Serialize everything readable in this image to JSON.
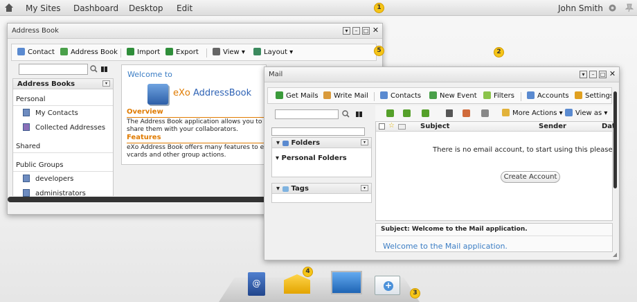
{
  "topbar": {
    "menu": [
      "My Sites",
      "Dashboard",
      "Desktop",
      "Edit"
    ],
    "user": "John Smith",
    "icons": [
      "home-icon",
      "gear-icon",
      "pin-icon"
    ]
  },
  "badges": {
    "b1": "1",
    "b2": "2",
    "b3": "3",
    "b4": "4",
    "b5": "5"
  },
  "addressbook": {
    "title": "Address Book",
    "toolbar": [
      "Contact",
      "Address Book",
      "Import",
      "Export",
      "View",
      "Layout"
    ],
    "panel_title": "Address Books",
    "sections": {
      "personal": "Personal",
      "shared": "Shared",
      "public": "Public Groups"
    },
    "personal_items": [
      "My Contacts",
      "Collected Addresses"
    ],
    "public_items": [
      "developers",
      "administrators"
    ],
    "welcome": {
      "heading": "Welcome to",
      "logo_prefix": "eXo",
      "logo_suffix": "AddressBook",
      "overview_title": "Overview",
      "overview_text1": "The Address Book application allows you to imp",
      "overview_text2": "share them with your collaborators.",
      "features_title": "Features",
      "features_text1": "eXo Address Book offers many features to enh",
      "features_text2": "vcards and other group actions."
    }
  },
  "mail": {
    "title": "Mail",
    "toolbar": [
      "Get Mails",
      "Write Mail",
      "Contacts",
      "New Event",
      "Filters",
      "Accounts",
      "Settings"
    ],
    "list_toolbar": {
      "more": "More Actions",
      "viewas": "View as"
    },
    "columns": [
      "Subject",
      "Sender",
      "Dat"
    ],
    "folders_title": "Folders",
    "personal_folders": "Personal Folders",
    "tags_title": "Tags",
    "empty_message": "There is no email account, to start using this please click the",
    "create_account": "Create Account",
    "preview_subject": "Subject: Welcome to the Mail application.",
    "preview_body": "Welcome to the Mail application."
  },
  "colors": {
    "accent": "#3b7dc4",
    "orange": "#e07b00",
    "badge": "#f5c518"
  }
}
